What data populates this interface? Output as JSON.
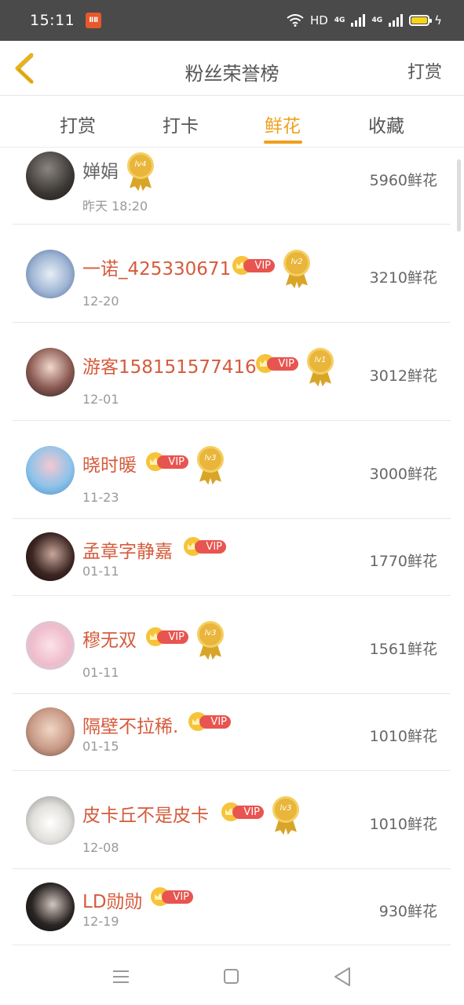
{
  "status_bar": {
    "time": "15:11",
    "app_badge": "ⅡⅡ",
    "hd_label": "HD",
    "net1": "4G",
    "net2": "4G"
  },
  "header": {
    "title": "粉丝荣誉榜",
    "action": "打赏"
  },
  "tabs": [
    {
      "label": "打赏",
      "active": false
    },
    {
      "label": "打卡",
      "active": false
    },
    {
      "label": "鲜花",
      "active": true
    },
    {
      "label": "收藏",
      "active": false
    }
  ],
  "entries": [
    {
      "name": "婵娟",
      "date": "昨天 18:20",
      "score": "5960鲜花",
      "vip": false,
      "level": "lv4"
    },
    {
      "name": "一诺_425330671",
      "date": "12-20",
      "score": "3210鲜花",
      "vip": true,
      "level": "lv2"
    },
    {
      "name": "游客158151577416",
      "date": "12-01",
      "score": "3012鲜花",
      "vip": true,
      "level": "lv1"
    },
    {
      "name": "晓时暖",
      "date": "11-23",
      "score": "3000鲜花",
      "vip": true,
      "level": "lv3"
    },
    {
      "name": "孟章字静嘉",
      "date": "01-11",
      "score": "1770鲜花",
      "vip": true,
      "level": ""
    },
    {
      "name": "穆无双",
      "date": "01-11",
      "score": "1561鲜花",
      "vip": true,
      "level": "lv3"
    },
    {
      "name": "隔壁不拉稀.",
      "date": "01-15",
      "score": "1010鲜花",
      "vip": true,
      "level": ""
    },
    {
      "name": "皮卡丘不是皮卡",
      "date": "12-08",
      "score": "1010鲜花",
      "vip": true,
      "level": "lv3"
    },
    {
      "name": "LD勋勋",
      "date": "12-19",
      "score": "930鲜花",
      "vip": true,
      "level": ""
    }
  ],
  "vip_label": "VIP",
  "colors": {
    "accent": "#f0a01d",
    "name_vip": "#d55b3c",
    "vip_pill": "#e8544f",
    "medal": "#e9b53a"
  },
  "icons": [
    "back-arrow-icon",
    "wifi-icon",
    "signal-icon",
    "battery-icon",
    "vip-crown-icon",
    "level-medal-icon",
    "nav-menu-icon",
    "nav-home-icon",
    "nav-back-icon"
  ]
}
